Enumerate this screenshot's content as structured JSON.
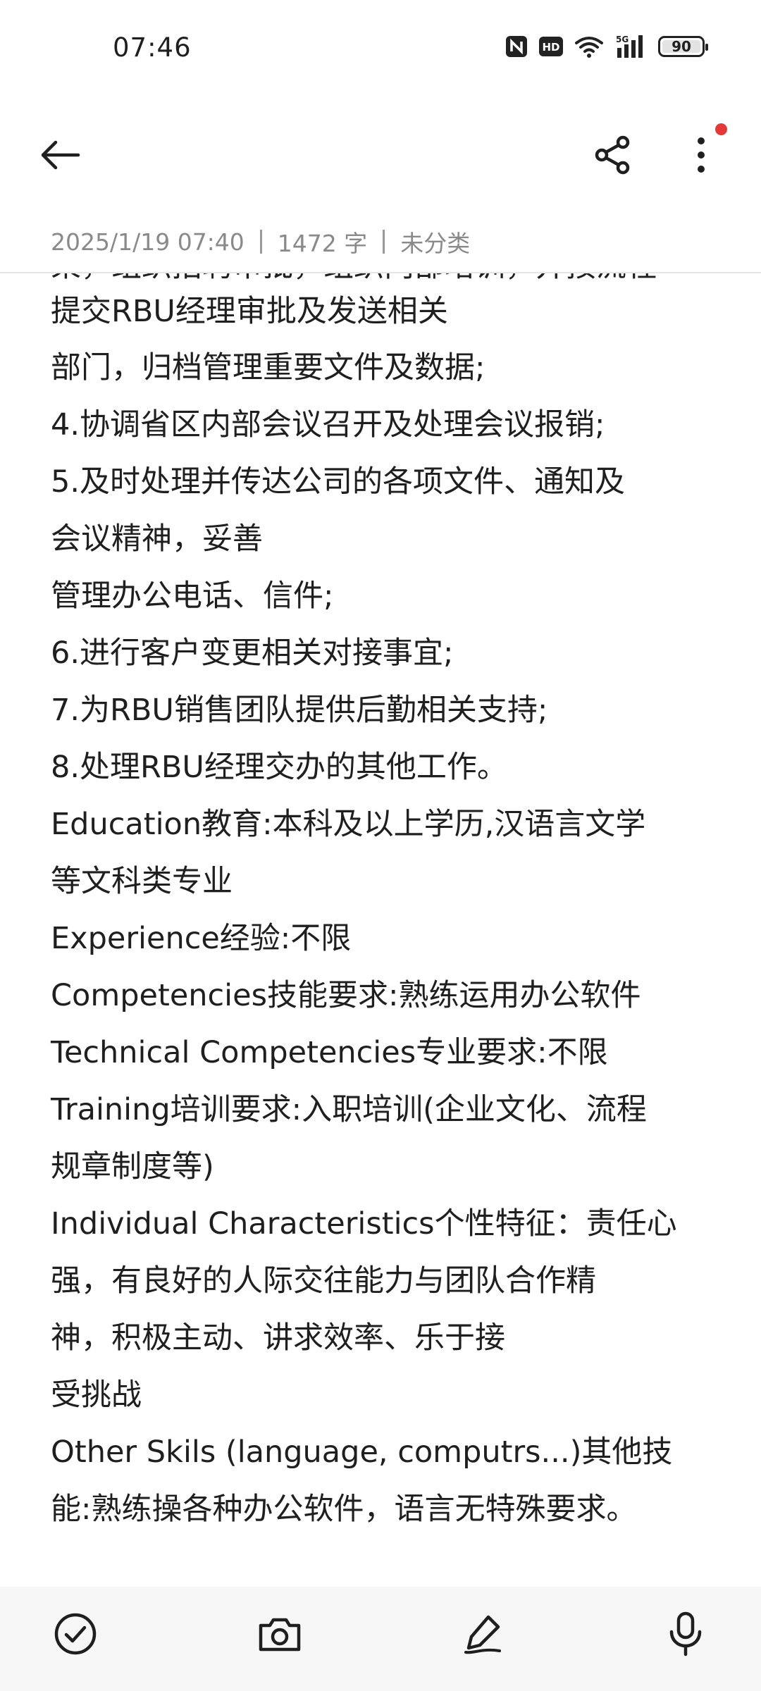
{
  "status_bar": {
    "time": "07:46",
    "network_badge": "HD",
    "signal_label": "5G",
    "battery_level": 90,
    "battery_text": "90"
  },
  "toolbar": {
    "back_icon": "arrow-left-icon",
    "share_icon": "share-icon",
    "more_icon": "more-vert-icon",
    "notification_color": "#e53935"
  },
  "note_meta": {
    "date": "2025/1/19 07:40",
    "word_count": "1472 字",
    "category": "未分类"
  },
  "note_body": {
    "lines": [
      "束，组织招聘审批，组织内部培训，并按流程",
      "提交RBU经理审批及发送相关",
      "部门，归档管理重要文件及数据;",
      "4.协调省区内部会议召开及处理会议报销;",
      "5.及时处理并传达公司的各项文件、通知及",
      "会议精神，妥善",
      "管理办公电话、信件;",
      "6.进行客户变更相关对接事宜;",
      "7.为RBU销售团队提供后勤相关支持;",
      "8.处理RBU经理交办的其他工作。",
      "Education教育:本科及以上学历,汉语言文学",
      "等文科类专业",
      "Experience经验:不限",
      "Competencies技能要求:熟练运用办公软件",
      "Technical Competencies专业要求:不限",
      "Training培训要求:入职培训(企业文化、流程",
      "规章制度等)",
      "Individual Characteristics个性特征：责任心",
      "强，有良好的人际交往能力与团队合作精",
      "神，积极主动、讲求效率、乐于接",
      "受挑战",
      "Other Skils (language, computrs...)其他技",
      "能:熟练操各种办公软件，语言无特殊要求。"
    ]
  },
  "bottom_bar": {
    "items": [
      {
        "icon": "checklist-icon"
      },
      {
        "icon": "camera-icon"
      },
      {
        "icon": "pen-icon"
      },
      {
        "icon": "microphone-icon"
      }
    ]
  }
}
